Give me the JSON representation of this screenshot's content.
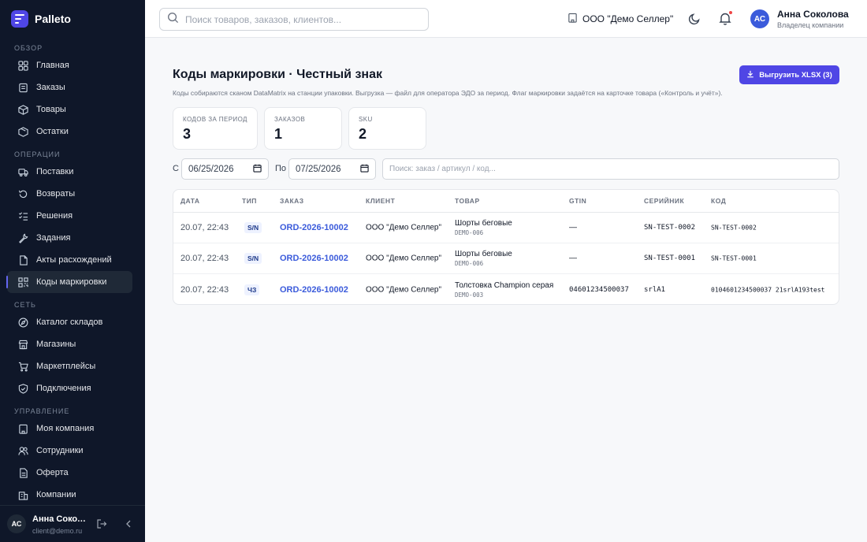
{
  "app": {
    "name": "Palleto"
  },
  "sidebar": {
    "sections": [
      {
        "title": "ОБЗОР",
        "items": [
          {
            "label": "Главная",
            "icon": "grid-icon"
          },
          {
            "label": "Заказы",
            "icon": "orders-icon"
          },
          {
            "label": "Товары",
            "icon": "box-icon"
          },
          {
            "label": "Остатки",
            "icon": "stock-icon"
          }
        ]
      },
      {
        "title": "ОПЕРАЦИИ",
        "items": [
          {
            "label": "Поставки",
            "icon": "truck-icon"
          },
          {
            "label": "Возвраты",
            "icon": "return-icon"
          },
          {
            "label": "Решения",
            "icon": "checklist-icon"
          },
          {
            "label": "Задания",
            "icon": "wrench-icon"
          },
          {
            "label": "Акты расхождений",
            "icon": "document-icon"
          },
          {
            "label": "Коды маркировки",
            "icon": "qr-icon",
            "active": true
          }
        ]
      },
      {
        "title": "СЕТЬ",
        "items": [
          {
            "label": "Каталог складов",
            "icon": "compass-icon"
          },
          {
            "label": "Магазины",
            "icon": "store-icon"
          },
          {
            "label": "Маркетплейсы",
            "icon": "cart-icon"
          },
          {
            "label": "Подключения",
            "icon": "shield-icon"
          }
        ]
      },
      {
        "title": "УПРАВЛЕНИЕ",
        "items": [
          {
            "label": "Моя компания",
            "icon": "building-icon"
          },
          {
            "label": "Сотрудники",
            "icon": "users-icon"
          },
          {
            "label": "Оферта",
            "icon": "file-icon"
          },
          {
            "label": "Компании",
            "icon": "company-icon"
          }
        ]
      }
    ],
    "user": {
      "initials": "АС",
      "name": "Анна Соколова",
      "email": "client@demo.ru"
    }
  },
  "header": {
    "search_placeholder": "Поиск товаров, заказов, клиентов...",
    "company": "ООО \"Демо Селлер\"",
    "user": {
      "initials": "АС",
      "name": "Анна Соколова",
      "role": "Владелец компании"
    }
  },
  "page": {
    "title": "Коды маркировки · Честный знак",
    "subtitle": "Коды собираются сканом DataMatrix на станции упаковки. Выгрузка — файл для оператора ЭДО за период. Флаг маркировки задаётся на карточке товара («Контроль и учёт»).",
    "export_label": "Выгрузить XLSX (3)"
  },
  "stats": [
    {
      "label": "КОДОВ ЗА ПЕРИОД",
      "value": "3"
    },
    {
      "label": "ЗАКАЗОВ",
      "value": "1"
    },
    {
      "label": "SKU",
      "value": "2"
    }
  ],
  "filters": {
    "from_label": "С",
    "from_value": "06/25/2026",
    "to_label": "По",
    "to_value": "07/25/2026",
    "search_placeholder": "Поиск: заказ / артикул / код..."
  },
  "table": {
    "columns": [
      "ДАТА",
      "ТИП",
      "ЗАКАЗ",
      "КЛИЕНТ",
      "ТОВАР",
      "GTIN",
      "СЕРИЙНИК",
      "КОД"
    ],
    "rows": [
      {
        "date": "20.07, 22:43",
        "type": "S/N",
        "order": "ORD-2026-10002",
        "client": "ООО \"Демо Селлер\"",
        "product": "Шорты беговые",
        "sku": "DEMO-006",
        "gtin": "—",
        "serial": "SN-TEST-0002",
        "code": "SN-TEST-0002"
      },
      {
        "date": "20.07, 22:43",
        "type": "S/N",
        "order": "ORD-2026-10002",
        "client": "ООО \"Демо Селлер\"",
        "product": "Шорты беговые",
        "sku": "DEMO-006",
        "gtin": "—",
        "serial": "SN-TEST-0001",
        "code": "SN-TEST-0001"
      },
      {
        "date": "20.07, 22:43",
        "type": "ЧЗ",
        "order": "ORD-2026-10002",
        "client": "ООО \"Демо Селлер\"",
        "product": "Толстовка Champion серая",
        "sku": "DEMO-003",
        "gtin": "04601234500037",
        "serial": "srlA1",
        "code": "0104601234500037 21srlA1\u001d93test"
      }
    ]
  },
  "colors": {
    "sidebar_bg": "#0f1729",
    "accent": "#4f46e5",
    "link": "#3b5bdb"
  }
}
